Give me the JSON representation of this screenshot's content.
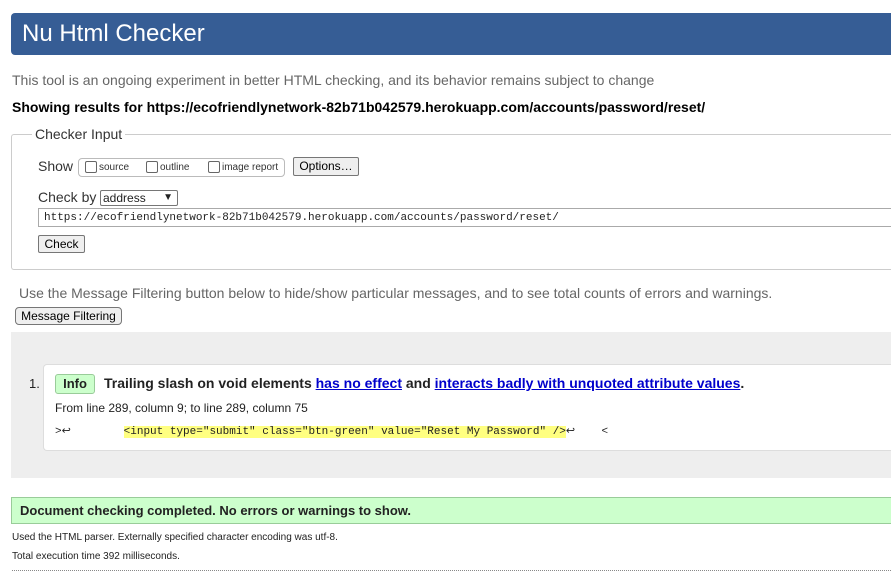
{
  "header": {
    "title": "Nu Html Checker"
  },
  "tagline": "This tool is an ongoing experiment in better HTML checking, and its behavior remains subject to change",
  "showing": "Showing results for https://ecofriendlynetwork-82b71b042579.herokuapp.com/accounts/password/reset/",
  "checker_input": {
    "legend": "Checker Input",
    "show_label": "Show",
    "options": [
      {
        "label": "source",
        "checked": false
      },
      {
        "label": "outline",
        "checked": false
      },
      {
        "label": "image report",
        "checked": false
      }
    ],
    "options_button": "Options…",
    "check_by_label": "Check by",
    "check_by_value": "address",
    "url_value": "https://ecofriendlynetwork-82b71b042579.herokuapp.com/accounts/password/reset/",
    "check_button": "Check"
  },
  "filter_hint": "Use the Message Filtering button below to hide/show particular messages, and to see total counts of errors and warnings.",
  "filter_button": "Message Filtering",
  "messages": [
    {
      "number": "1.",
      "type": "Info",
      "text_start": "Trailing slash on void elements",
      "link1": "has no effect",
      "text_mid": "and",
      "link2": "interacts badly with unquoted attribute values",
      "text_end": ".",
      "location": "From line 289, column 9; to line 289, column 75",
      "extract_before": ">↩        ",
      "extract_highlight": "<input type=\"submit\" class=\"btn-green\" value=\"Reset My Password\" />",
      "extract_after": "↩    <"
    }
  ],
  "success": "Document checking completed. No errors or warnings to show.",
  "footer": {
    "parser": "Used the HTML parser. Externally specified character encoding was utf-8.",
    "time": "Total execution time 392 milliseconds."
  },
  "colors": {
    "header_bg": "#365d95",
    "info_bg": "#ccffcc",
    "highlight": "#ffff80",
    "link": "#0000cc"
  }
}
